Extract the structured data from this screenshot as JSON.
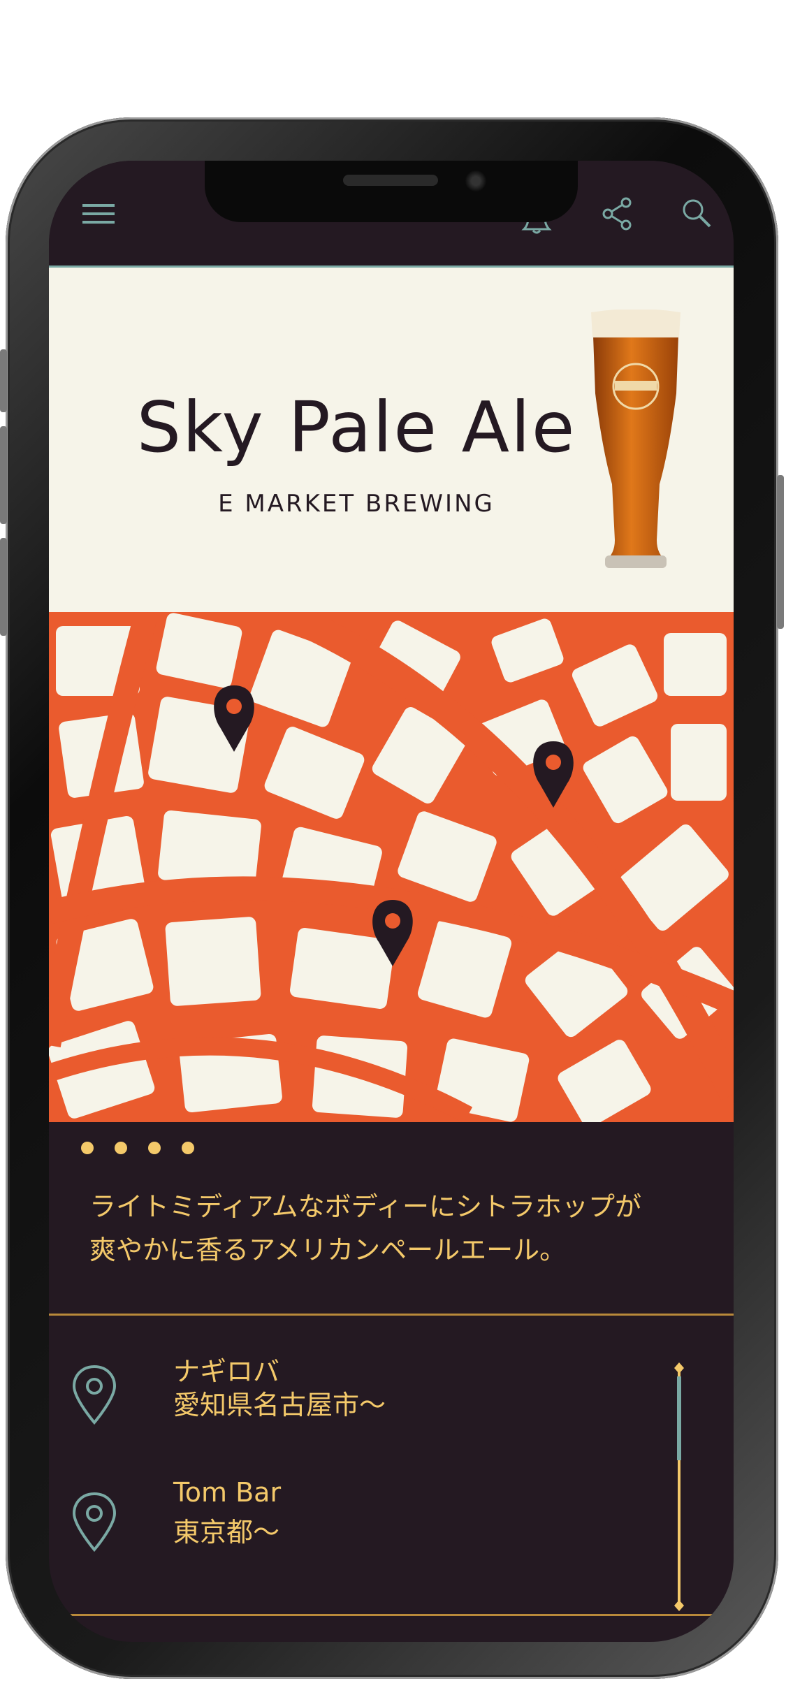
{
  "product": {
    "name": "Sky Pale Ale",
    "brewery": "E MARKET BREWING",
    "description_line1": "ライトミディアムなボディーにシトラホップが",
    "description_line2": "爽やかに香るアメリカンペールエール。"
  },
  "carousel": {
    "page_count": 4
  },
  "map": {
    "pins": [
      "map-pin",
      "map-pin",
      "map-pin"
    ]
  },
  "locations": [
    {
      "name": "ナギロバ",
      "area": "愛知県名古屋市〜",
      "icon": "location-pin-icon"
    },
    {
      "name": "Tom Bar",
      "area": "東京都〜",
      "icon": "location-pin-icon"
    }
  ],
  "icons": {
    "menu": "hamburger-menu-icon",
    "notification": "bell-icon",
    "share": "share-icon",
    "search": "search-icon"
  },
  "colors": {
    "background_dark": "#241922",
    "cream": "#f6f4e9",
    "map_orange": "#ea5b2e",
    "accent_yellow": "#f4c96a",
    "accent_teal": "#7aa9a4",
    "divider_gold": "#b8893a"
  }
}
